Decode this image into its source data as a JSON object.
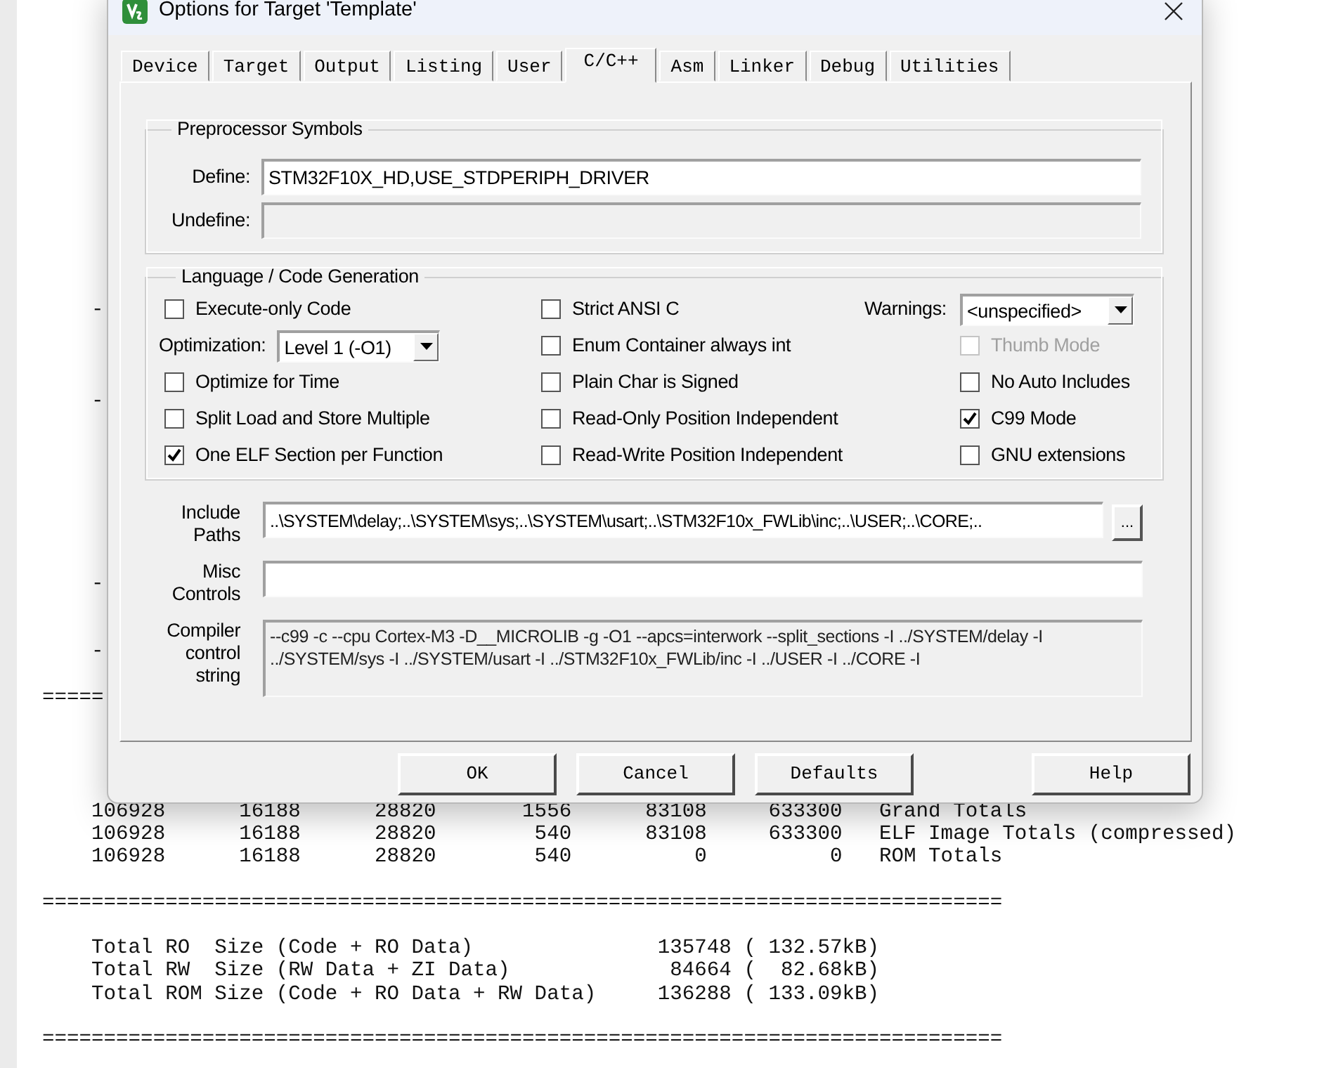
{
  "window": {
    "title": "Options for Target 'Template'"
  },
  "tabs": [
    {
      "label": "Device",
      "selected": false
    },
    {
      "label": "Target",
      "selected": false
    },
    {
      "label": "Output",
      "selected": false
    },
    {
      "label": "Listing",
      "selected": false
    },
    {
      "label": "User",
      "selected": false
    },
    {
      "label": "C/C++",
      "selected": true
    },
    {
      "label": "Asm",
      "selected": false
    },
    {
      "label": "Linker",
      "selected": false
    },
    {
      "label": "Debug",
      "selected": false
    },
    {
      "label": "Utilities",
      "selected": false
    }
  ],
  "preprocessor_symbols": {
    "title": "Preprocessor Symbols",
    "fields": [
      {
        "label": "Define:",
        "value": "STM32F10X_HD,USE_STDPERIPH_DRIVER",
        "disabled": false
      },
      {
        "label": "Undefine:",
        "disabled": true
      }
    ]
  },
  "language": {
    "title": "Language / Code Generation",
    "columns": [
      [
        {
          "kind": "checkbox",
          "label": "Execute-only Code",
          "checked": false,
          "disabled": false
        },
        {
          "kind": "select",
          "label": "Optimization:",
          "value": "Level 1 (-O1)"
        },
        {
          "kind": "checkbox",
          "label": "Optimize for Time",
          "checked": false,
          "disabled": false
        },
        {
          "kind": "checkbox",
          "label": "Split Load and Store Multiple",
          "checked": false,
          "disabled": false
        },
        {
          "kind": "checkbox",
          "label": "One ELF Section per Function",
          "checked": true,
          "disabled": false
        }
      ],
      [
        {
          "kind": "checkbox",
          "label": "Strict ANSI C",
          "checked": false,
          "disabled": false
        },
        {
          "kind": "checkbox",
          "label": "Enum Container always int",
          "checked": false,
          "disabled": false
        },
        {
          "kind": "checkbox",
          "label": "Plain Char is Signed",
          "checked": false,
          "disabled": false
        },
        {
          "kind": "checkbox",
          "label": "Read-Only Position Independent",
          "checked": false,
          "disabled": false
        },
        {
          "kind": "checkbox",
          "label": "Read-Write Position Independent",
          "checked": false,
          "disabled": false
        }
      ],
      [
        {
          "kind": "select",
          "label": "Warnings:",
          "value": "<unspecified>"
        },
        {
          "kind": "checkbox",
          "label": "Thumb Mode",
          "checked": false,
          "disabled": true
        },
        {
          "kind": "checkbox",
          "label": "No Auto Includes",
          "checked": false,
          "disabled": false
        },
        {
          "kind": "checkbox",
          "label": "C99 Mode",
          "checked": true,
          "disabled": false
        },
        {
          "kind": "checkbox",
          "label": "GNU extensions",
          "checked": false,
          "disabled": false
        }
      ]
    ]
  },
  "paths": [
    {
      "kind": "browse",
      "label": "Include Paths",
      "value": "..\\SYSTEM\\delay;..\\SYSTEM\\sys;..\\SYSTEM\\usart;..\\STM32F10x_FWLib\\inc;..\\USER;..\\CORE;..",
      "button": "...",
      "disabled": false
    },
    {
      "kind": "plain",
      "label": "Misc Controls",
      "disabled": false
    },
    {
      "kind": "multiline",
      "label": "Compiler control string",
      "value": "--c99 -c --cpu Cortex-M3 -D__MICROLIB -g -O1 --apcs=interwork --split_sections -I ../SYSTEM/delay -I ../SYSTEM/sys -I ../SYSTEM/usart -I ../STM32F10x_FWLib/inc -I ../USER -I ../CORE -I",
      "disabled": true
    }
  ],
  "buttons": [
    "OK",
    "Cancel",
    "Defaults",
    "Help"
  ],
  "listing": [
    {
      "kind": "text",
      "text": "    -"
    },
    {
      "kind": "blank"
    },
    {
      "kind": "blank"
    },
    {
      "kind": "blank"
    },
    {
      "kind": "text",
      "text": "    -"
    },
    {
      "kind": "blank"
    },
    {
      "kind": "blank"
    },
    {
      "kind": "blank"
    },
    {
      "kind": "blank"
    },
    {
      "kind": "blank"
    },
    {
      "kind": "blank"
    },
    {
      "kind": "blank"
    },
    {
      "kind": "text",
      "text": "    -"
    },
    {
      "kind": "blank"
    },
    {
      "kind": "blank"
    },
    {
      "kind": "text",
      "text": "    -"
    },
    {
      "kind": "blank"
    },
    {
      "kind": "text",
      "text": "====="
    },
    {
      "kind": "blank"
    },
    {
      "kind": "blank"
    },
    {
      "kind": "blank"
    },
    {
      "kind": "blank"
    },
    {
      "kind": "text",
      "text": "    106928      16188      28820       1556      83108     633300   Grand Totals"
    },
    {
      "kind": "text",
      "text": "    106928      16188      28820        540      83108     633300   ELF Image Totals (compressed)"
    },
    {
      "kind": "text",
      "text": "    106928      16188      28820        540          0          0   ROM Totals"
    },
    {
      "kind": "blank"
    },
    {
      "kind": "text",
      "text": "=============================================================================="
    },
    {
      "kind": "blank"
    },
    {
      "kind": "text",
      "text": "    Total RO  Size (Code + RO Data)               135748 ( 132.57kB)"
    },
    {
      "kind": "text",
      "text": "    Total RW  Size (RW Data + ZI Data)             84664 (  82.68kB)"
    },
    {
      "kind": "text",
      "text": "    Total ROM Size (Code + RO Data + RW Data)     136288 ( 133.09kB)"
    },
    {
      "kind": "blank"
    },
    {
      "kind": "text",
      "text": "=============================================================================="
    }
  ]
}
